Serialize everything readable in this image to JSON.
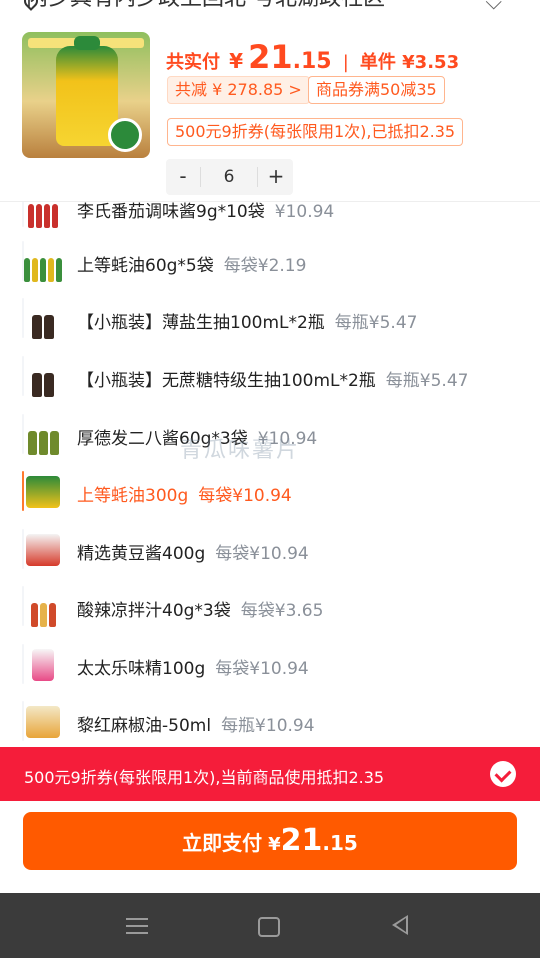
{
  "address": {
    "text": "内乡具有内乡政上回北 号北湖政社区"
  },
  "product": {
    "paid_label": "共实付",
    "currency": "¥",
    "paid_int": "21",
    "paid_dec": ".15",
    "separator": "|",
    "unit_label": "单件 ¥3.53",
    "total_reduce": "共减 ¥ 278.85 >",
    "coupon_tag": "商品券满50减35",
    "coupon500_tag": "500元9折券(每张限用1次),已抵扣2.35",
    "qty_minus": "-",
    "qty_value": "6",
    "qty_plus": "+"
  },
  "items": [
    {
      "name": "李氏番茄调味酱9g*10袋",
      "price": "¥10.94",
      "icon": "condiment-packs-icon"
    },
    {
      "name": "上等蚝油60g*5袋",
      "price": "每袋¥2.19",
      "icon": "oyster-sauce-sachets-icon"
    },
    {
      "name": "【小瓶装】薄盐生抽100mL*2瓶",
      "price": "每瓶¥5.47",
      "icon": "soy-sauce-bottles-icon"
    },
    {
      "name": "【小瓶装】无蔗糖特级生抽100mL*2瓶",
      "price": "每瓶¥5.47",
      "icon": "soy-sauce-bottles-icon"
    },
    {
      "name": "厚德发二八酱60g*3袋",
      "price": "¥10.94",
      "icon": "sauce-pouches-icon"
    },
    {
      "name": "上等蚝油300g",
      "price": "每袋¥10.94",
      "icon": "oyster-sauce-bag-icon",
      "selected": true
    },
    {
      "name": "精选黄豆酱400g",
      "price": "每袋¥10.94",
      "icon": "soybean-paste-icon"
    },
    {
      "name": "酸辣凉拌汁40g*3袋",
      "price": "每袋¥3.65",
      "icon": "sour-spicy-sauce-icon"
    },
    {
      "name": "太太乐味精100g",
      "price": "每袋¥10.94",
      "icon": "msg-bag-icon"
    },
    {
      "name": "黎红麻椒油-50ml",
      "price": "每瓶¥10.94",
      "icon": "pepper-oil-bottle-icon"
    }
  ],
  "watermark": "青瓜味薯片",
  "coupon_bar": {
    "text": "500元9折券(每张限用1次),当前商品使用抵扣2.35"
  },
  "pay": {
    "label": "立即支付",
    "currency": "¥",
    "int": "21",
    "dec": ".15"
  },
  "colors": {
    "accent": "#ff5a00",
    "coupon_bar": "#f51d3a",
    "price_text": "#ff4a1f"
  }
}
